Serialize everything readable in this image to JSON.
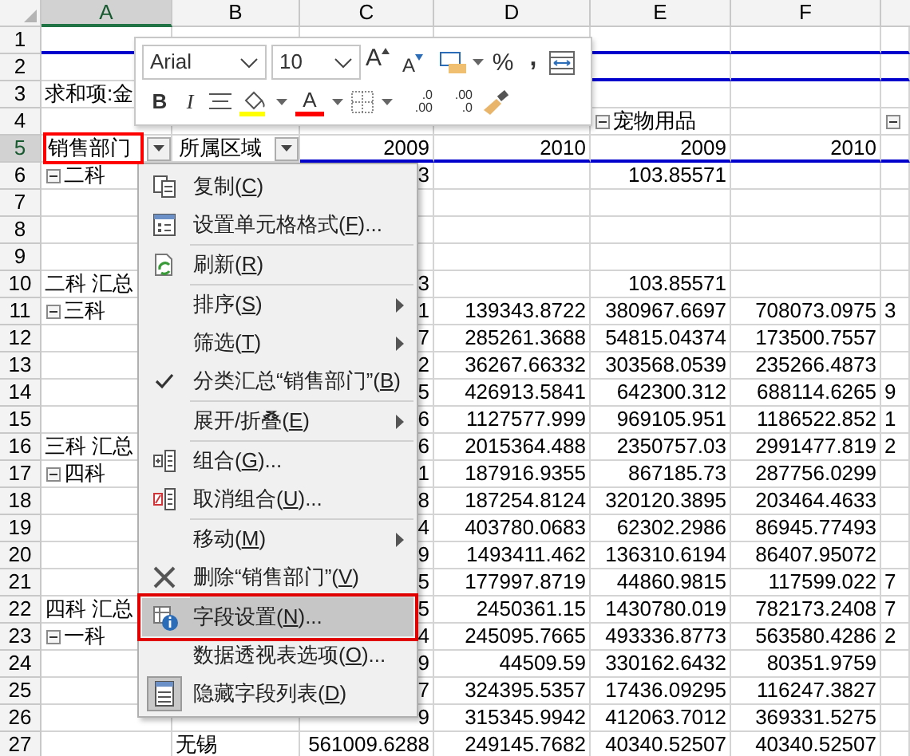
{
  "columns": [
    {
      "label": "A",
      "selected": true
    },
    {
      "label": "B",
      "selected": false
    },
    {
      "label": "C",
      "selected": false
    },
    {
      "label": "D",
      "selected": false
    },
    {
      "label": "E",
      "selected": false
    },
    {
      "label": "F",
      "selected": false
    }
  ],
  "rows": [
    {
      "header": "1",
      "selected": false,
      "cells": {}
    },
    {
      "header": "2",
      "selected": false,
      "cells": {}
    },
    {
      "header": "3",
      "selected": false,
      "cells": {
        "a": {
          "kind": "label",
          "text": "求和项:金"
        }
      }
    },
    {
      "header": "4",
      "selected": false,
      "cells": {
        "e": {
          "kind": "toggle",
          "text": "宠物用品"
        },
        "g": {
          "kind": "toggle_only"
        }
      }
    },
    {
      "header": "5",
      "selected": true,
      "cells": {
        "a": {
          "kind": "field",
          "text": "销售部门",
          "highlighted": true
        },
        "b": {
          "kind": "field",
          "text": "所属区域",
          "highlighted": false
        },
        "c": {
          "kind": "number",
          "text": "2009"
        },
        "d": {
          "kind": "number",
          "text": "2010"
        },
        "e": {
          "kind": "number",
          "text": "2009"
        },
        "f": {
          "kind": "number",
          "text": "2010"
        }
      }
    },
    {
      "header": "6",
      "selected": false,
      "cells": {
        "a": {
          "kind": "toggle",
          "text": "二科"
        },
        "c": {
          "kind": "number",
          "text": "3"
        },
        "e": {
          "kind": "number",
          "text": "103.85571"
        }
      }
    },
    {
      "header": "7",
      "selected": false,
      "cells": {}
    },
    {
      "header": "8",
      "selected": false,
      "cells": {}
    },
    {
      "header": "9",
      "selected": false,
      "cells": {}
    },
    {
      "header": "10",
      "selected": false,
      "cells": {
        "a": {
          "kind": "label",
          "text": "二科 汇总"
        },
        "c": {
          "kind": "number",
          "text": "3"
        },
        "e": {
          "kind": "number",
          "text": "103.85571"
        }
      }
    },
    {
      "header": "11",
      "selected": false,
      "cells": {
        "a": {
          "kind": "toggle",
          "text": "三科"
        },
        "c": {
          "kind": "number",
          "text": "1"
        },
        "d": {
          "kind": "number",
          "text": "139343.8722"
        },
        "e": {
          "kind": "number",
          "text": "380967.6697"
        },
        "f": {
          "kind": "number",
          "text": "708073.0975"
        },
        "g": {
          "kind": "label",
          "text": "3"
        }
      }
    },
    {
      "header": "12",
      "selected": false,
      "cells": {
        "c": {
          "kind": "number",
          "text": "7"
        },
        "d": {
          "kind": "number",
          "text": "285261.3688"
        },
        "e": {
          "kind": "number",
          "text": "54815.04374"
        },
        "f": {
          "kind": "number",
          "text": "173500.7557"
        }
      }
    },
    {
      "header": "13",
      "selected": false,
      "cells": {
        "c": {
          "kind": "number",
          "text": "2"
        },
        "d": {
          "kind": "number",
          "text": "36267.66332"
        },
        "e": {
          "kind": "number",
          "text": "303568.0539"
        },
        "f": {
          "kind": "number",
          "text": "235266.4873"
        }
      }
    },
    {
      "header": "14",
      "selected": false,
      "cells": {
        "c": {
          "kind": "number",
          "text": "5"
        },
        "d": {
          "kind": "number",
          "text": "426913.5841"
        },
        "e": {
          "kind": "number",
          "text": "642300.312"
        },
        "f": {
          "kind": "number",
          "text": "688114.6265"
        },
        "g": {
          "kind": "label",
          "text": "9"
        }
      }
    },
    {
      "header": "15",
      "selected": false,
      "cells": {
        "c": {
          "kind": "number",
          "text": "6"
        },
        "d": {
          "kind": "number",
          "text": "1127577.999"
        },
        "e": {
          "kind": "number",
          "text": "969105.951"
        },
        "f": {
          "kind": "number",
          "text": "1186522.852"
        },
        "g": {
          "kind": "label",
          "text": "1"
        }
      }
    },
    {
      "header": "16",
      "selected": false,
      "cells": {
        "a": {
          "kind": "label",
          "text": "三科 汇总"
        },
        "c": {
          "kind": "number",
          "text": "6"
        },
        "d": {
          "kind": "number",
          "text": "2015364.488"
        },
        "e": {
          "kind": "number",
          "text": "2350757.03"
        },
        "f": {
          "kind": "number",
          "text": "2991477.819"
        },
        "g": {
          "kind": "label",
          "text": "2"
        }
      }
    },
    {
      "header": "17",
      "selected": false,
      "cells": {
        "a": {
          "kind": "toggle",
          "text": "四科"
        },
        "c": {
          "kind": "number",
          "text": "1"
        },
        "d": {
          "kind": "number",
          "text": "187916.9355"
        },
        "e": {
          "kind": "number",
          "text": "867185.73"
        },
        "f": {
          "kind": "number",
          "text": "287756.0299"
        }
      }
    },
    {
      "header": "18",
      "selected": false,
      "cells": {
        "c": {
          "kind": "number",
          "text": "8"
        },
        "d": {
          "kind": "number",
          "text": "187254.8124"
        },
        "e": {
          "kind": "number",
          "text": "320120.3895"
        },
        "f": {
          "kind": "number",
          "text": "203464.4633"
        }
      }
    },
    {
      "header": "19",
      "selected": false,
      "cells": {
        "c": {
          "kind": "number",
          "text": "4"
        },
        "d": {
          "kind": "number",
          "text": "403780.0683"
        },
        "e": {
          "kind": "number",
          "text": "62302.2986"
        },
        "f": {
          "kind": "number",
          "text": "86945.77493"
        }
      }
    },
    {
      "header": "20",
      "selected": false,
      "cells": {
        "c": {
          "kind": "number",
          "text": "9"
        },
        "d": {
          "kind": "number",
          "text": "1493411.462"
        },
        "e": {
          "kind": "number",
          "text": "136310.6194"
        },
        "f": {
          "kind": "number",
          "text": "86407.95072"
        }
      }
    },
    {
      "header": "21",
      "selected": false,
      "cells": {
        "c": {
          "kind": "number",
          "text": "5"
        },
        "d": {
          "kind": "number",
          "text": "177997.8719"
        },
        "e": {
          "kind": "number",
          "text": "44860.9815"
        },
        "f": {
          "kind": "number",
          "text": "117599.022"
        },
        "g": {
          "kind": "label",
          "text": "7"
        }
      }
    },
    {
      "header": "22",
      "selected": false,
      "cells": {
        "a": {
          "kind": "label",
          "text": "四科 汇总"
        },
        "c": {
          "kind": "number",
          "text": "5"
        },
        "d": {
          "kind": "number",
          "text": "2450361.15"
        },
        "e": {
          "kind": "number",
          "text": "1430780.019"
        },
        "f": {
          "kind": "number",
          "text": "782173.2408"
        },
        "g": {
          "kind": "label",
          "text": "7"
        }
      }
    },
    {
      "header": "23",
      "selected": false,
      "cells": {
        "a": {
          "kind": "toggle",
          "text": "一科"
        },
        "c": {
          "kind": "number",
          "text": "4"
        },
        "d": {
          "kind": "number",
          "text": "245095.7665"
        },
        "e": {
          "kind": "number",
          "text": "493336.8773"
        },
        "f": {
          "kind": "number",
          "text": "563580.4286"
        },
        "g": {
          "kind": "label",
          "text": "2"
        }
      }
    },
    {
      "header": "24",
      "selected": false,
      "cells": {
        "c": {
          "kind": "number",
          "text": "9"
        },
        "d": {
          "kind": "number",
          "text": "44509.59"
        },
        "e": {
          "kind": "number",
          "text": "330162.6432"
        },
        "f": {
          "kind": "number",
          "text": "80351.9759"
        }
      }
    },
    {
      "header": "25",
      "selected": false,
      "cells": {
        "c": {
          "kind": "number",
          "text": "7"
        },
        "d": {
          "kind": "number",
          "text": "324395.5357"
        },
        "e": {
          "kind": "number",
          "text": "17436.09295"
        },
        "f": {
          "kind": "number",
          "text": "116247.3827"
        }
      }
    },
    {
      "header": "26",
      "selected": false,
      "cells": {
        "c": {
          "kind": "number",
          "text": "9"
        },
        "d": {
          "kind": "number",
          "text": "315345.9942"
        },
        "e": {
          "kind": "number",
          "text": "412063.7012"
        },
        "f": {
          "kind": "number",
          "text": "369331.5275"
        }
      }
    },
    {
      "header": "27",
      "selected": false,
      "cells": {
        "b": {
          "kind": "label",
          "text": "无锡"
        },
        "c": {
          "kind": "number",
          "text": "561009.6288"
        },
        "d": {
          "kind": "number",
          "text": "249145.7682"
        },
        "e": {
          "kind": "number",
          "text": "40340.52507"
        },
        "f": {
          "kind": "number",
          "text": "40340.52507"
        }
      }
    }
  ],
  "mini_toolbar": {
    "font": "Arial",
    "size": "10",
    "percent": "%",
    "comma": ",",
    "bold": "B",
    "italic": "I",
    "font_color": "A",
    "grow": "A",
    "shrink": "A",
    "increase_decimal": {
      "top": ".0",
      "bottom": ".00"
    },
    "decrease_decimal": {
      "top": ".00",
      "bottom": ".0"
    }
  },
  "context_menu": [
    {
      "kind": "copy",
      "label": [
        "复制(",
        "C",
        ")"
      ],
      "submenu": false,
      "checked": false,
      "selected": false
    },
    {
      "kind": "format",
      "label": [
        "设置单元格格式(",
        "F",
        ")..."
      ],
      "submenu": false,
      "checked": false,
      "selected": false
    },
    {
      "kind": "separator"
    },
    {
      "kind": "refresh",
      "label": [
        "刷新(",
        "R",
        ")"
      ],
      "submenu": false,
      "checked": false,
      "selected": false
    },
    {
      "kind": "separator"
    },
    {
      "kind": "plain",
      "label": [
        "排序(",
        "S",
        ")"
      ],
      "submenu": true,
      "checked": false,
      "selected": false
    },
    {
      "kind": "plain",
      "label": [
        "筛选(",
        "T",
        ")"
      ],
      "submenu": true,
      "checked": false,
      "selected": false
    },
    {
      "kind": "plain",
      "label": [
        "分类汇总“销售部门”(",
        "B",
        ")"
      ],
      "submenu": false,
      "checked": true,
      "selected": false
    },
    {
      "kind": "separator"
    },
    {
      "kind": "plain",
      "label": [
        "展开/折叠(",
        "E",
        ")"
      ],
      "submenu": true,
      "checked": false,
      "selected": false
    },
    {
      "kind": "separator"
    },
    {
      "kind": "group",
      "label": [
        "组合(",
        "G",
        ")..."
      ],
      "submenu": false,
      "checked": false,
      "selected": false
    },
    {
      "kind": "ungroup",
      "label": [
        "取消组合(",
        "U",
        ")..."
      ],
      "submenu": false,
      "checked": false,
      "selected": false
    },
    {
      "kind": "separator"
    },
    {
      "kind": "plain",
      "label": [
        "移动(",
        "M",
        ")"
      ],
      "submenu": true,
      "checked": false,
      "selected": false
    },
    {
      "kind": "delete",
      "label": [
        "删除“销售部门”(",
        "V",
        ")"
      ],
      "submenu": false,
      "checked": false,
      "selected": false
    },
    {
      "kind": "separator"
    },
    {
      "kind": "field",
      "label": [
        "字段设置(",
        "N",
        ")..."
      ],
      "submenu": false,
      "checked": false,
      "selected": true
    },
    {
      "kind": "plain",
      "label": [
        "数据透视表选项(",
        "O",
        ")..."
      ],
      "submenu": false,
      "checked": false,
      "selected": false
    },
    {
      "kind": "list",
      "label": [
        "隐藏字段列表(",
        "D",
        ")"
      ],
      "submenu": false,
      "checked": false,
      "selected": false
    }
  ]
}
